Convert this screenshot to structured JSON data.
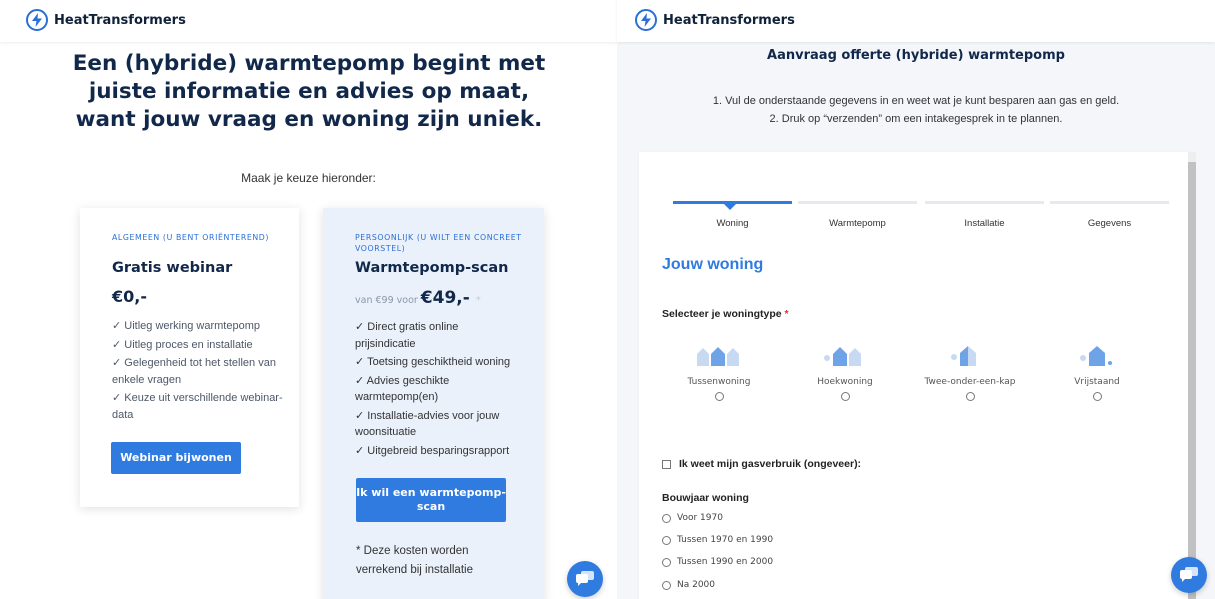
{
  "brand": {
    "name": "HeatTransformers",
    "accent": "#2f7be0",
    "dark": "#11284a"
  },
  "left": {
    "headline": "Een (hybride) warmtepomp begint met juiste informatie en advies op maat, want jouw vraag en woning zijn uniek.",
    "subtitle": "Maak je keuze hieronder:",
    "cards": [
      {
        "kicker": "ALGEMEEN (U BENT ORIËNTEREND)",
        "title": "Gratis webinar",
        "price": "€0,-",
        "features": [
          "✓ Uitleg werking warmtepomp",
          "✓ Uitleg proces en installatie",
          "✓ Gelegenheid tot het stellen van enkele vragen",
          "✓ Keuze uit verschillende webinar-data"
        ],
        "button": "Webinar bijwonen"
      },
      {
        "kicker": "PERSOONLIJK (U WILT EEN CONCREET VOORSTEL)",
        "title": "Warmtepomp-scan",
        "price_prefix": "van €99 voor",
        "price": "€49,-",
        "price_star": "*",
        "features": [
          "✓ Direct gratis online prijsindicatie",
          "✓ Toetsing geschiktheid woning",
          "✓ Advies geschikte warmtepomp(en)",
          "✓ Installatie-advies voor jouw woonsituatie",
          "✓ Uitgebreid besparingsrapport"
        ],
        "button": "Ik wil een warmtepomp-scan",
        "note": "* Deze kosten worden verrekend bij installatie"
      }
    ]
  },
  "right": {
    "title": "Aanvraag offerte (hybride) warmtepomp",
    "step1": "1. Vul de onderstaande gegevens in en weet wat je kunt besparen aan gas en geld.",
    "step2": "2. Druk op “verzenden” om een intakegesprek in te plannen.",
    "steps": [
      "Woning",
      "Warmtepomp",
      "Installatie",
      "Gegevens"
    ],
    "active_step": 0,
    "section_title": "Jouw woning",
    "woningtype_label": "Selecteer je woningtype",
    "required_mark": "*",
    "woningtypes": [
      "Tussenwoning",
      "Hoekwoning",
      "Twee-onder-een-kap",
      "Vrijstaand"
    ],
    "gas_checkbox": "Ik weet mijn gasverbruik (ongeveer):",
    "bouwjaar_label": "Bouwjaar woning",
    "bouwjaar_options": [
      "Voor 1970",
      "Tussen 1970 en 1990",
      "Tussen 1990 en 2000",
      "Na 2000"
    ]
  }
}
